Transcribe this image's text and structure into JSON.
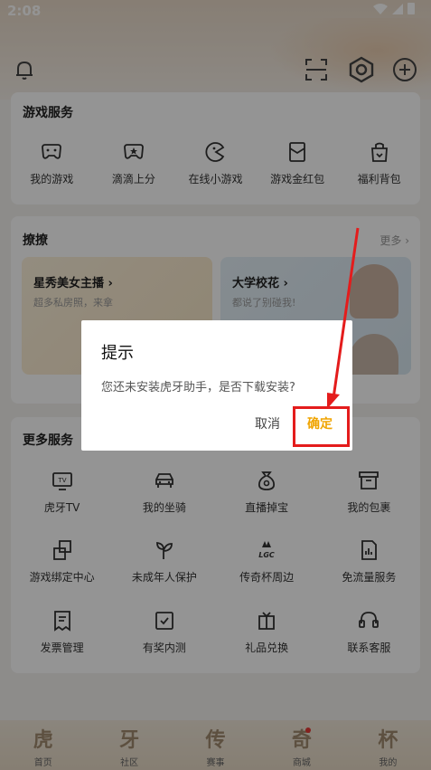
{
  "status": {
    "time": "2:08"
  },
  "header": {
    "icons": [
      "bell-icon",
      "scan-icon",
      "hexagon-settings-icon",
      "add-icon"
    ]
  },
  "game_services": {
    "title": "游戏服务",
    "items": [
      {
        "label": "我的游戏",
        "icon": "gamepad-icon"
      },
      {
        "label": "滴滴上分",
        "icon": "gamepad-star-icon"
      },
      {
        "label": "在线小游戏",
        "icon": "pacman-icon"
      },
      {
        "label": "游戏金红包",
        "icon": "red-envelope-icon"
      },
      {
        "label": "福利背包",
        "icon": "gift-bag-icon"
      }
    ]
  },
  "liao": {
    "title": "撩撩",
    "more": "更多 ›",
    "cards": [
      {
        "title": "星秀美女主播 ›",
        "sub": "超多私房照，来拿"
      },
      {
        "title": "大学校花 ›",
        "sub": "都说了别碰我!"
      }
    ]
  },
  "more_services": {
    "title": "更多服务",
    "rows": [
      [
        {
          "label": "虎牙TV",
          "icon": "tv-icon"
        },
        {
          "label": "我的坐骑",
          "icon": "car-icon"
        },
        {
          "label": "直播掉宝",
          "icon": "money-bag-icon"
        },
        {
          "label": "我的包裹",
          "icon": "package-icon"
        }
      ],
      [
        {
          "label": "游戏绑定中心",
          "icon": "link-icon"
        },
        {
          "label": "未成年人保护",
          "icon": "sprout-icon"
        },
        {
          "label": "传奇杯周边",
          "icon": "lgc-logo-icon"
        },
        {
          "label": "免流量服务",
          "icon": "sim-data-icon"
        }
      ],
      [
        {
          "label": "发票管理",
          "icon": "invoice-icon"
        },
        {
          "label": "有奖内测",
          "icon": "checkbox-icon"
        },
        {
          "label": "礼品兑换",
          "icon": "gift-exchange-icon"
        },
        {
          "label": "联系客服",
          "icon": "headset-icon"
        }
      ]
    ]
  },
  "bottom_nav": [
    {
      "glyph": "虎",
      "label": "首页"
    },
    {
      "glyph": "牙",
      "label": "社区"
    },
    {
      "glyph": "传",
      "label": "赛事"
    },
    {
      "glyph": "奇",
      "label": "商城",
      "dot": true
    },
    {
      "glyph": "杯",
      "label": "我的"
    }
  ],
  "dialog": {
    "title": "提示",
    "message": "您还未安装虎牙助手，是否下载安装?",
    "cancel": "取消",
    "confirm": "确定"
  },
  "colors": {
    "accent": "#f0a400",
    "annotation": "#e41c1c"
  }
}
